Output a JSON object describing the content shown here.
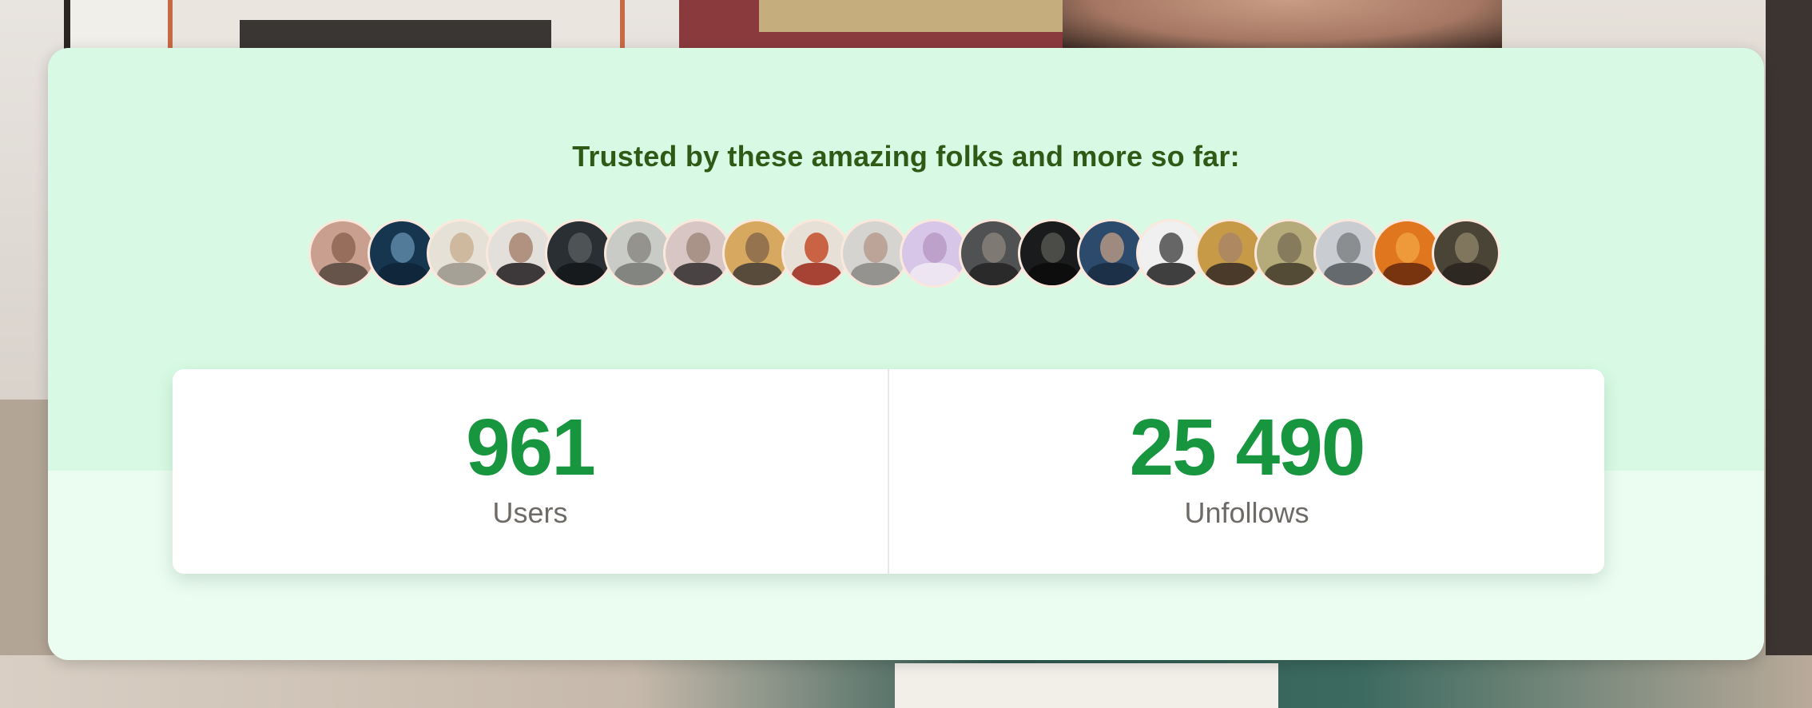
{
  "headline": "Trusted by these amazing folks and more so far:",
  "avatars": [
    {
      "name": "user-avatar",
      "bg": "#c9a08f",
      "head": "#8e6452",
      "torso": "#5b4b44"
    },
    {
      "name": "user-avatar",
      "bg": "#163650",
      "head": "#5d86a6",
      "torso": "#0f2638"
    },
    {
      "name": "user-avatar",
      "bg": "#e6e1d6",
      "head": "#c9b194",
      "torso": "#9e9a90"
    },
    {
      "name": "user-avatar",
      "bg": "#e3dfda",
      "head": "#a8846e",
      "torso": "#2a2628"
    },
    {
      "name": "user-avatar",
      "bg": "#2a2f33",
      "head": "#55595c",
      "torso": "#141819"
    },
    {
      "name": "user-avatar",
      "bg": "#c9cbc6",
      "head": "#8c8a82",
      "torso": "#7b7e78"
    },
    {
      "name": "user-avatar",
      "bg": "#d8c6c4",
      "head": "#a1887d",
      "torso": "#3a3436"
    },
    {
      "name": "user-avatar",
      "bg": "#d6a860",
      "head": "#8a6a4c",
      "torso": "#4a4038"
    },
    {
      "name": "user-avatar",
      "bg": "#e6e0d6",
      "head": "#c44b2a",
      "torso": "#a03222"
    },
    {
      "name": "user-avatar",
      "bg": "#d6d4d1",
      "head": "#b79c8e",
      "torso": "#8e8c88"
    },
    {
      "name": "user-avatar",
      "bg": "#d8c6e8",
      "head": "#b89ac4",
      "torso": "#f1e8f3"
    },
    {
      "name": "user-avatar",
      "bg": "#4f5152",
      "head": "#87807a",
      "torso": "#262626"
    },
    {
      "name": "user-avatar",
      "bg": "#1a1b1c",
      "head": "#55534f",
      "torso": "#0c0c0c"
    },
    {
      "name": "user-avatar",
      "bg": "#2c4a6b",
      "head": "#b49584",
      "torso": "#1b2f44"
    },
    {
      "name": "user-avatar",
      "bg": "#f0f0f0",
      "head": "#4e4e4e",
      "torso": "#2b2b2b"
    },
    {
      "name": "user-avatar",
      "bg": "#c79a48",
      "head": "#a98565",
      "torso": "#3b3026"
    },
    {
      "name": "user-avatar",
      "bg": "#b4aa7a",
      "head": "#7e7458",
      "torso": "#48402d"
    },
    {
      "name": "user-avatar",
      "bg": "#c9ccd0",
      "head": "#7f8285",
      "torso": "#5a5f63"
    },
    {
      "name": "user-avatar",
      "bg": "#e0761e",
      "head": "#f0a040",
      "torso": "#6b2d0c"
    },
    {
      "name": "user-avatar",
      "bg": "#4a4436",
      "head": "#8a7e64",
      "torso": "#2a2620"
    }
  ],
  "stats": [
    {
      "value": "961",
      "label": "Users"
    },
    {
      "value": "25 490",
      "label": "Unfollows"
    }
  ],
  "colors": {
    "card_top": "#d8fae4",
    "card_bottom": "#ebfcf1",
    "headline": "#2f5a16",
    "stat_value": "#18963f",
    "stat_label": "#6e6a66"
  }
}
